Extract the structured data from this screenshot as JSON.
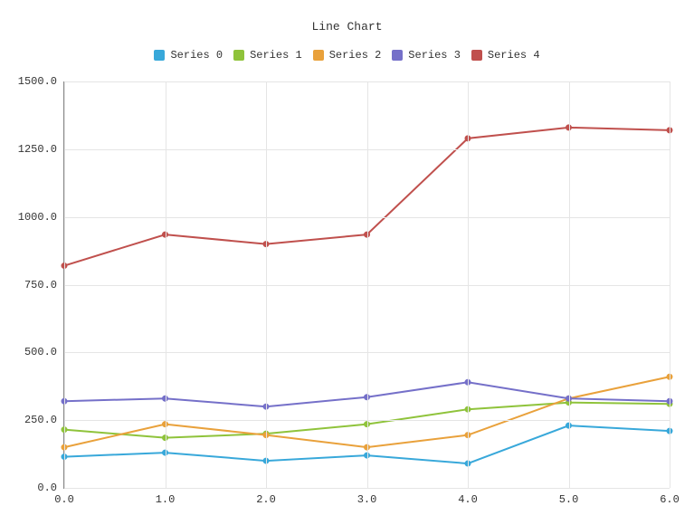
{
  "chart_data": {
    "type": "line",
    "title": "Line Chart",
    "xlabel": "",
    "ylabel": "",
    "xlim": [
      0,
      6
    ],
    "ylim": [
      0,
      1500
    ],
    "x": [
      0,
      1,
      2,
      3,
      4,
      5,
      6
    ],
    "x_tick_labels": [
      "0.0",
      "1.0",
      "2.0",
      "3.0",
      "4.0",
      "5.0",
      "6.0"
    ],
    "y_ticks": [
      0,
      250,
      500,
      750,
      1000,
      1250,
      1500
    ],
    "y_tick_labels": [
      "0.0",
      "250.0",
      "500.0",
      "750.0",
      "1000.0",
      "1250.0",
      "1500.0"
    ],
    "series": [
      {
        "name": "Series 0",
        "color": "#38a8da",
        "values": [
          115,
          130,
          100,
          120,
          90,
          230,
          210
        ]
      },
      {
        "name": "Series 1",
        "color": "#8fc33b",
        "values": [
          215,
          185,
          200,
          235,
          290,
          315,
          310
        ]
      },
      {
        "name": "Series 2",
        "color": "#e9a13b",
        "values": [
          150,
          235,
          195,
          150,
          195,
          330,
          410
        ]
      },
      {
        "name": "Series 3",
        "color": "#7570c9",
        "values": [
          320,
          330,
          300,
          335,
          390,
          330,
          320
        ]
      },
      {
        "name": "Series 4",
        "color": "#c0504d",
        "values": [
          820,
          935,
          900,
          935,
          1290,
          1330,
          1320
        ]
      }
    ],
    "legend_position": "top",
    "grid": true
  }
}
